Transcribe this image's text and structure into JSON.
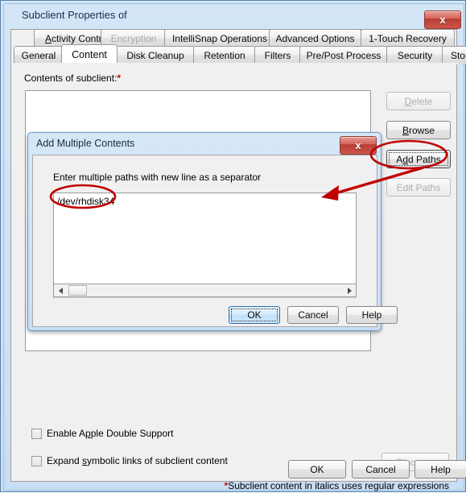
{
  "window": {
    "title": "Subclient Properties of",
    "close_label": "x"
  },
  "tabs": {
    "top_row": [
      {
        "label": "Activity Control",
        "mnemonic": "A",
        "state": "normal"
      },
      {
        "label": "Encryption",
        "state": "disabled"
      },
      {
        "label": "IntelliSnap Operations",
        "state": "normal"
      },
      {
        "label": "Advanced Options",
        "state": "normal"
      },
      {
        "label": "1-Touch Recovery",
        "state": "normal"
      }
    ],
    "bottom_row": [
      {
        "label": "General",
        "state": "normal"
      },
      {
        "label": "Content",
        "state": "active"
      },
      {
        "label": "Disk Cleanup",
        "state": "normal"
      },
      {
        "label": "Retention",
        "state": "normal"
      },
      {
        "label": "Filters",
        "state": "normal"
      },
      {
        "label": "Pre/Post Process",
        "state": "normal"
      },
      {
        "label": "Security",
        "state": "normal"
      },
      {
        "label": "Storage Device",
        "state": "normal"
      }
    ]
  },
  "content_page": {
    "contents_label": "Contents of subclient:",
    "required_marker": "*",
    "list_items": [],
    "buttons": {
      "delete": {
        "label": "Delete",
        "mnemonic": "D",
        "state": "disabled"
      },
      "browse": {
        "label": "Browse",
        "mnemonic": "B",
        "state": "normal"
      },
      "add_paths": {
        "label": "Add Paths",
        "mnemonic": "d",
        "state": "focused"
      },
      "edit_paths": {
        "label": "Edit Paths",
        "state": "disabled"
      }
    },
    "checkboxes": [
      {
        "label_before": "Enable A",
        "mnemonic": "p",
        "label_after": "ple Double Support",
        "checked": false
      },
      {
        "label_before": "Expand ",
        "mnemonic": "s",
        "label_after": "ymbolic links of subclient content",
        "checked": false
      }
    ],
    "discover_button": {
      "label": "Discover",
      "mnemonic": "i",
      "state": "disabled"
    },
    "regex_note_marker": "*",
    "regex_note": "Subclient content in italics uses regular expressions"
  },
  "outer_buttons": {
    "ok": "OK",
    "cancel": "Cancel",
    "help": "Help"
  },
  "inner_dialog": {
    "title": "Add Multiple Contents",
    "close_label": "x",
    "prompt": "Enter multiple paths with new line as a separator",
    "paths_value": "/dev/rhdisk34",
    "scrollbar": {
      "left_arrow": "left-arrow-icon",
      "right_arrow": "right-arrow-icon"
    },
    "buttons": {
      "ok": "OK",
      "cancel": "Cancel",
      "help": "Help"
    }
  },
  "annotations": {
    "color": "#c00000",
    "ellipse_add_paths": "highlights the Add Paths button",
    "ellipse_path_value": "highlights the /dev/rhdisk34 entry",
    "arrow": "points from Add Paths button to the paths text area"
  }
}
